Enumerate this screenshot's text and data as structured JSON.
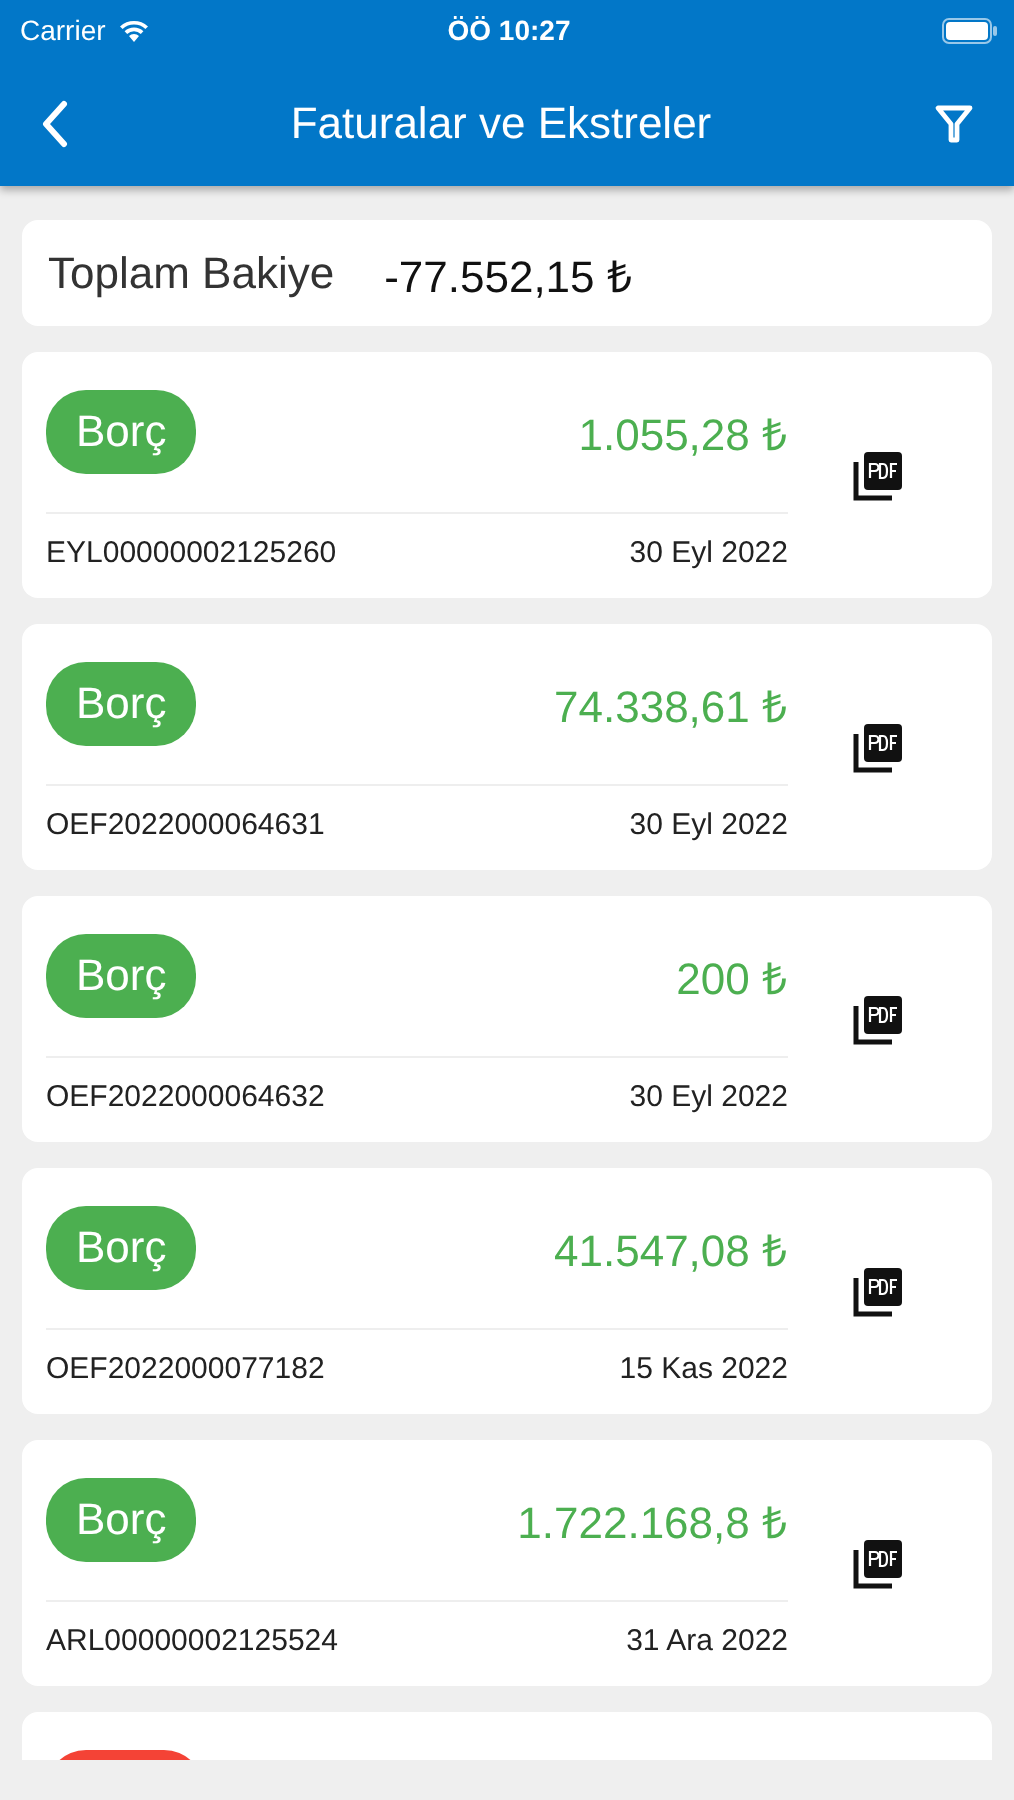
{
  "status_bar": {
    "carrier": "Carrier",
    "time": "ÖÖ 10:27"
  },
  "nav_bar": {
    "title": "Faturalar ve Ekstreler"
  },
  "total": {
    "label": "Toplam Bakiye",
    "amount": "-77.552,15 ₺"
  },
  "documents": [
    {
      "kind": "debt",
      "badge": "Borç",
      "amount": "1.055,28 ₺",
      "number": "EYL00000002125260",
      "date": "30 Eyl 2022"
    },
    {
      "kind": "debt",
      "badge": "Borç",
      "amount": "74.338,61 ₺",
      "number": "OEF2022000064631",
      "date": "30 Eyl 2022"
    },
    {
      "kind": "debt",
      "badge": "Borç",
      "amount": "200 ₺",
      "number": "OEF2022000064632",
      "date": "30 Eyl 2022"
    },
    {
      "kind": "debt",
      "badge": "Borç",
      "amount": "41.547,08 ₺",
      "number": "OEF2022000077182",
      "date": "15 Kas 2022"
    },
    {
      "kind": "debt",
      "badge": "Borç",
      "amount": "1.722.168,8 ₺",
      "number": "ARL00000002125524",
      "date": "31 Ara 2022"
    },
    {
      "kind": "credit"
    }
  ]
}
